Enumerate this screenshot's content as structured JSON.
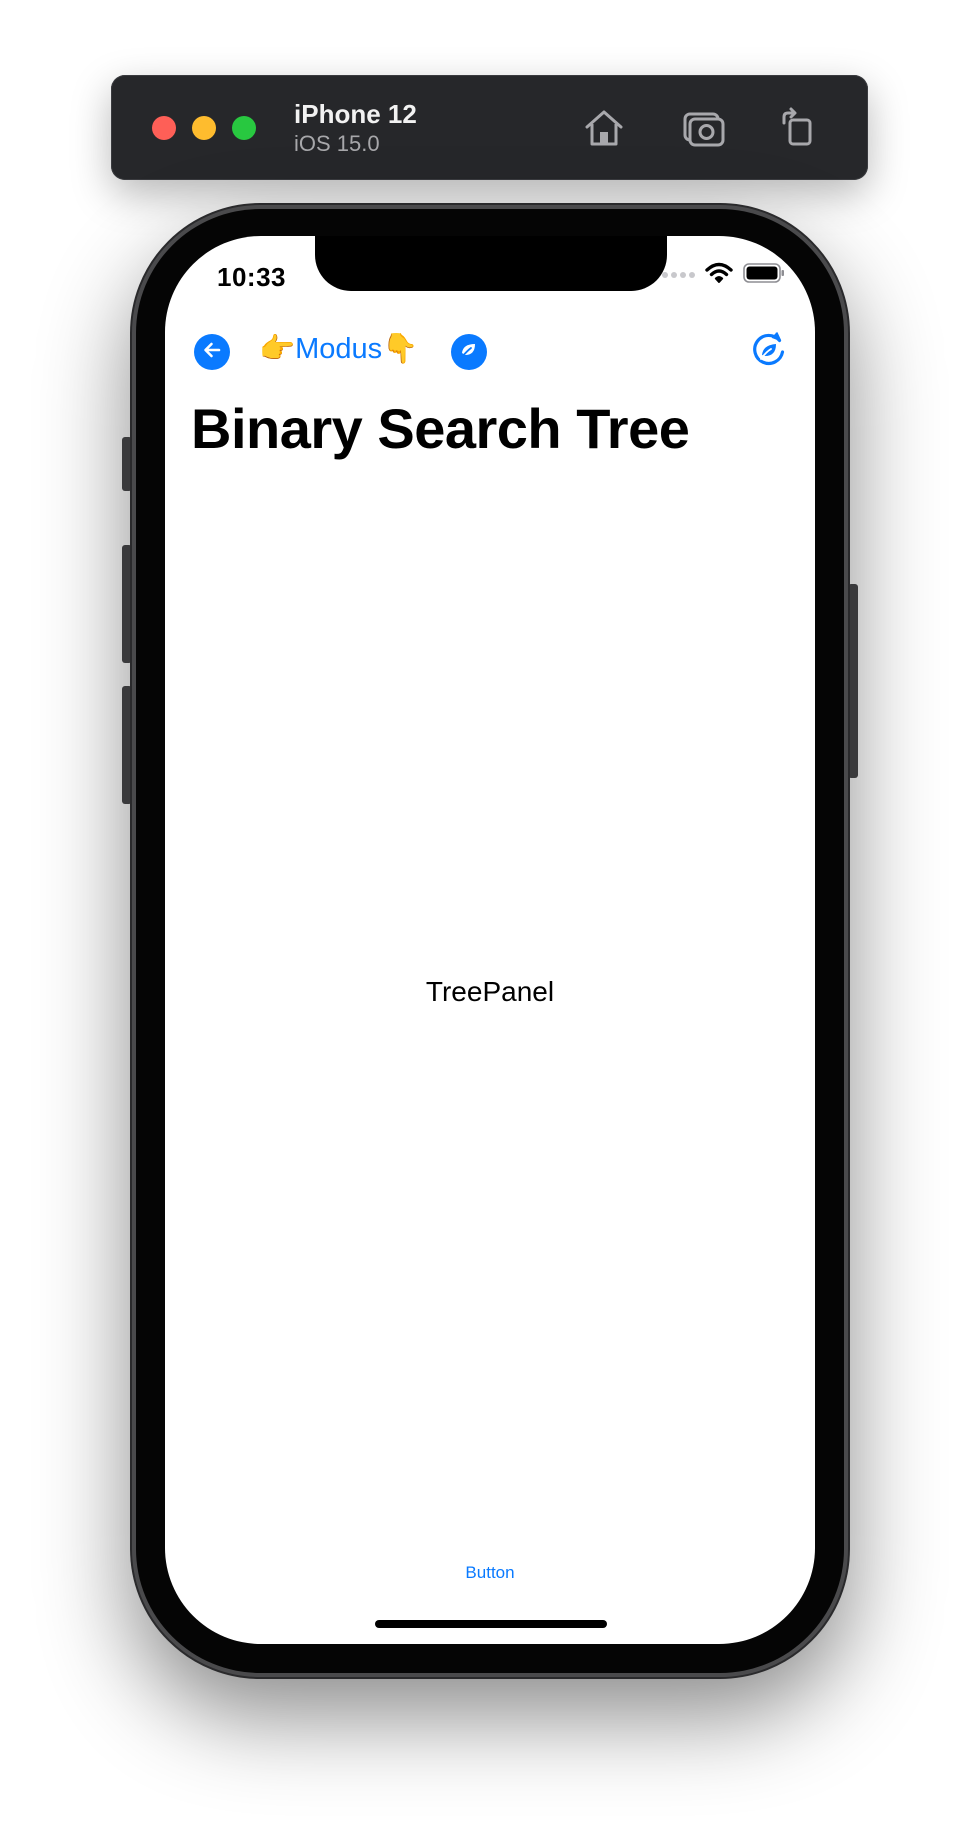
{
  "simulator": {
    "device_name": "iPhone 12",
    "os_version": "iOS 15.0",
    "toolbar_icons": [
      "home-icon",
      "screenshot-icon",
      "rotate-icon"
    ]
  },
  "status_bar": {
    "time": "10:33",
    "icons": [
      "signal-dots-icon",
      "wifi-icon",
      "battery-icon"
    ]
  },
  "nav": {
    "back_icon": "arrow-left-circle-icon",
    "modus_label": "👉Modus👇",
    "leaf_icon": "leaf-circle-icon",
    "refresh_icon": "refresh-leaf-icon"
  },
  "main": {
    "title": "Binary Search Tree",
    "tree_panel_label": "TreePanel",
    "button_label": "Button"
  },
  "colors": {
    "accent": "#0a7aff",
    "toolbar_bg": "#26272a",
    "traffic_red": "#fe5f57",
    "traffic_yellow": "#febc2e",
    "traffic_green": "#28c840"
  }
}
